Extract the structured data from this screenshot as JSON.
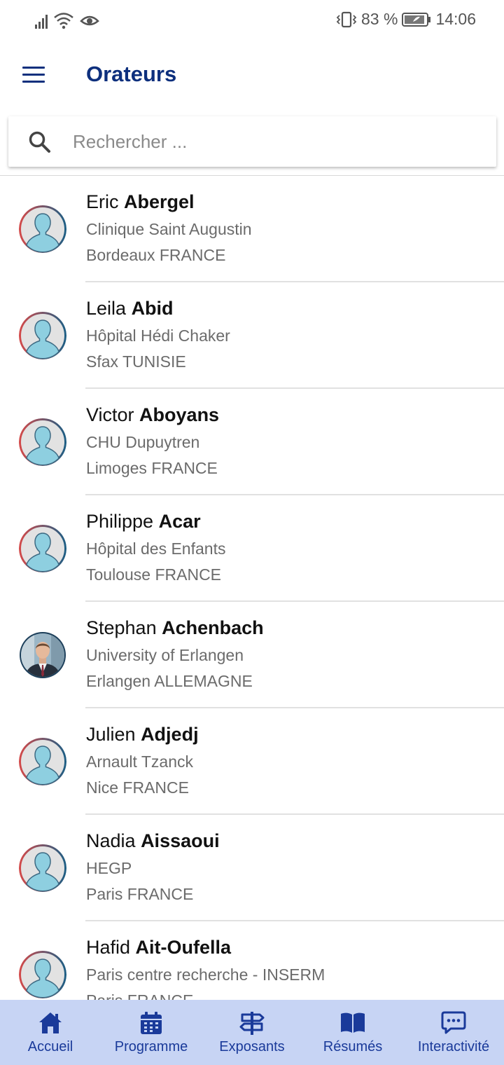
{
  "status_bar": {
    "battery_percent": "83 %",
    "time": "14:06"
  },
  "header": {
    "title": "Orateurs",
    "menu_icon": "hamburger-menu-icon"
  },
  "search": {
    "placeholder": "Rechercher ...",
    "value": ""
  },
  "speakers": [
    {
      "first_name": "Eric",
      "last_name": "Abergel",
      "institution": "Clinique Saint Augustin",
      "location": "Bordeaux FRANCE",
      "has_photo": false
    },
    {
      "first_name": "Leila",
      "last_name": "Abid",
      "institution": "Hôpital Hédi Chaker",
      "location": "Sfax TUNISIE",
      "has_photo": false
    },
    {
      "first_name": "Victor",
      "last_name": "Aboyans",
      "institution": "CHU Dupuytren",
      "location": "Limoges FRANCE",
      "has_photo": false
    },
    {
      "first_name": "Philippe",
      "last_name": "Acar",
      "institution": "Hôpital des Enfants",
      "location": "Toulouse FRANCE",
      "has_photo": false
    },
    {
      "first_name": "Stephan",
      "last_name": "Achenbach",
      "institution": "University of Erlangen",
      "location": "Erlangen ALLEMAGNE",
      "has_photo": true
    },
    {
      "first_name": "Julien",
      "last_name": "Adjedj",
      "institution": "Arnault Tzanck",
      "location": "Nice FRANCE",
      "has_photo": false
    },
    {
      "first_name": "Nadia",
      "last_name": "Aissaoui",
      "institution": "HEGP",
      "location": "Paris FRANCE",
      "has_photo": false
    },
    {
      "first_name": "Hafid",
      "last_name": "Ait-Oufella",
      "institution": "Paris centre recherche - INSERM",
      "location": "Paris FRANCE",
      "has_photo": false
    }
  ],
  "bottom_nav": [
    {
      "label": "Accueil",
      "icon": "home-icon"
    },
    {
      "label": "Programme",
      "icon": "calendar-icon"
    },
    {
      "label": "Exposants",
      "icon": "signpost-icon"
    },
    {
      "label": "Résumés",
      "icon": "book-icon"
    },
    {
      "label": "Interactivité",
      "icon": "chat-icon"
    }
  ],
  "colors": {
    "primary": "#0d2f7d",
    "nav_background": "#c7d4f4",
    "nav_foreground": "#1a3a9a",
    "avatar_fill": "#8ecfe0"
  }
}
